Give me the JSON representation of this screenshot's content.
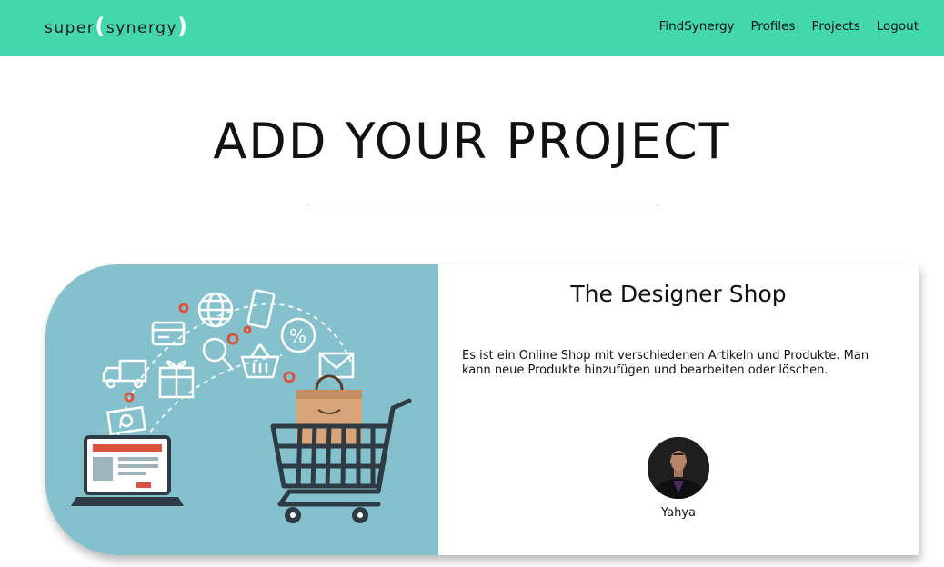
{
  "brand": {
    "name_prefix": "super",
    "paren_open": "(",
    "name_suffix": "synergy",
    "paren_close": ")",
    "accent_color": "#43d8ac"
  },
  "nav": {
    "items": [
      {
        "label": "FindSynergy"
      },
      {
        "label": "Profiles"
      },
      {
        "label": "Projects"
      },
      {
        "label": "Logout"
      }
    ]
  },
  "page": {
    "title": "ADD YOUR PROJECT"
  },
  "project": {
    "title": "The Designer Shop",
    "description": "Es ist ein Online Shop mit verschiedenen Artikeln und Produkte. Man kann neue Produkte hinzufügen und bearbeiten oder löschen.",
    "image_icon": "ecommerce-illustration",
    "image_bg_color": "#85c1cd",
    "owner": {
      "name": "Yahya",
      "avatar_icon": "user-avatar"
    }
  }
}
